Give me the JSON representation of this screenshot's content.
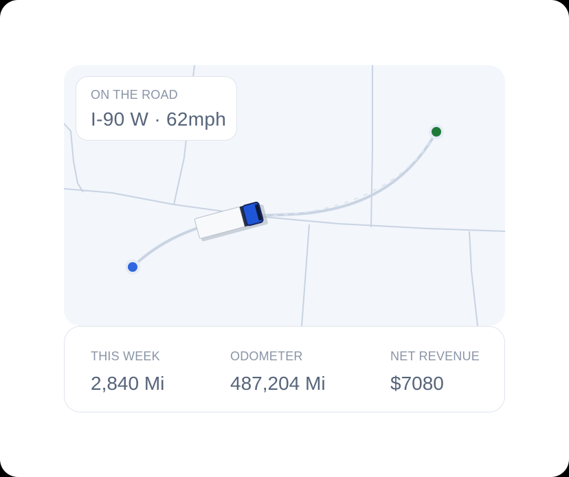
{
  "status_chip": {
    "label": "ON THE ROAD",
    "value": "I-90 W · 62mph"
  },
  "map": {
    "origin_color": "#2f66e0",
    "destination_color": "#1f7a3a",
    "route_color": "#c9d4e3",
    "vehicle_icon": "truck-icon",
    "vehicle_cab_color": "#1f56d8",
    "background_color": "#f3f6fb",
    "border_line_color": "#c8d3e2"
  },
  "stats": [
    {
      "label": "THIS WEEK",
      "value": "2,840 Mi"
    },
    {
      "label": "ODOMETER",
      "value": "487,204 Mi"
    },
    {
      "label": "NET REVENUE",
      "value": "$7080"
    }
  ]
}
